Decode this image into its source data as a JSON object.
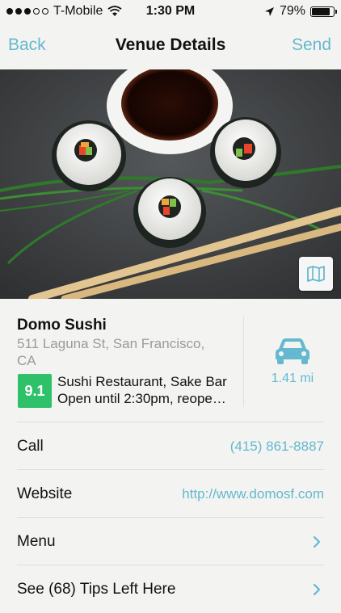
{
  "status_bar": {
    "carrier": "T-Mobile",
    "time": "1:30 PM",
    "battery": "79%",
    "battery_level": 0.79,
    "signal_bars_filled": 3,
    "signal_bars_total": 5
  },
  "nav": {
    "back_label": "Back",
    "title": "Venue Details",
    "send_label": "Send"
  },
  "hero": {
    "image_icon": "map-icon"
  },
  "venue": {
    "name": "Domo Sushi",
    "address": "511 Laguna St, San Francisco, CA",
    "score": "9.1",
    "category": "Sushi Restaurant, Sake Bar",
    "hours": "Open until 2:30pm, reopens…",
    "distance": "1.41 mi"
  },
  "rows": [
    {
      "label": "Call",
      "value": "(415) 861-8887"
    },
    {
      "label": "Website",
      "value": "http://www.domosf.com"
    },
    {
      "label": "Menu",
      "value": ""
    },
    {
      "label": "See (68) Tips Left Here",
      "value": ""
    }
  ],
  "colors": {
    "accent": "#64b8cf",
    "score_green": "#2fc06a"
  }
}
